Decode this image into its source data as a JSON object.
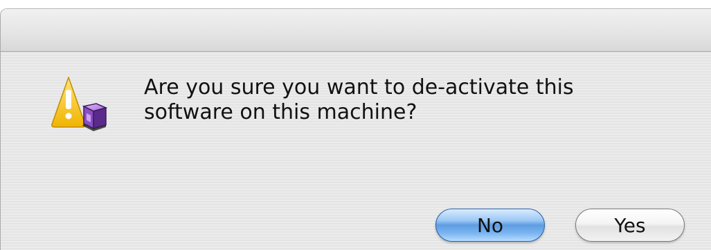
{
  "dialog": {
    "message_line1": "Are you sure you want to de-activate this",
    "message_line2": "software on this machine?",
    "icon": "caution-triangle-with-app-box-icon",
    "buttons": {
      "no_label": "No",
      "yes_label": "Yes"
    }
  },
  "colors": {
    "default_button": "#5f9de3",
    "warning_yellow": "#f6c520",
    "app_box_purple": "#7a3fb0"
  }
}
